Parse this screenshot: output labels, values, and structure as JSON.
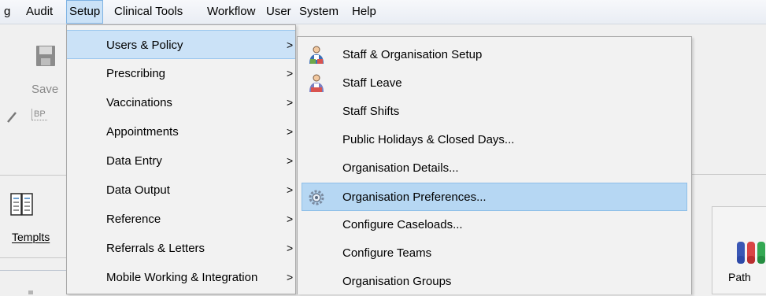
{
  "menubar": {
    "items": [
      "g",
      "Audit",
      "Setup",
      "Clinical Tools",
      "Workflow",
      "User",
      "System",
      "Help"
    ]
  },
  "toolbar": {
    "save_label": "Save",
    "bp_label": "BP",
    "templates_label": "Templts",
    "path_label": "Path"
  },
  "menu": {
    "items": [
      {
        "label": "Users & Policy",
        "arrow": ">"
      },
      {
        "label": "Prescribing",
        "arrow": ">"
      },
      {
        "label": "Vaccinations",
        "arrow": ">"
      },
      {
        "label": "Appointments",
        "arrow": ">"
      },
      {
        "label": "Data Entry",
        "arrow": ">"
      },
      {
        "label": "Data Output",
        "arrow": ">"
      },
      {
        "label": "Reference",
        "arrow": ">"
      },
      {
        "label": "Referrals & Letters",
        "arrow": ">"
      },
      {
        "label": "Mobile Working & Integration",
        "arrow": ">"
      }
    ]
  },
  "submenu": {
    "items": [
      {
        "label": "Staff & Organisation Setup"
      },
      {
        "label": "Staff Leave"
      },
      {
        "label": "Staff Shifts"
      },
      {
        "label": "Public Holidays & Closed Days..."
      },
      {
        "label": "Organisation Details..."
      },
      {
        "label": "Organisation Preferences..."
      },
      {
        "label": "Configure Caseloads..."
      },
      {
        "label": "Configure Teams"
      },
      {
        "label": "Organisation Groups"
      }
    ]
  },
  "colors": {
    "menu_highlight": "#cbe2f7",
    "submenu_highlight": "#b6d7f3"
  }
}
